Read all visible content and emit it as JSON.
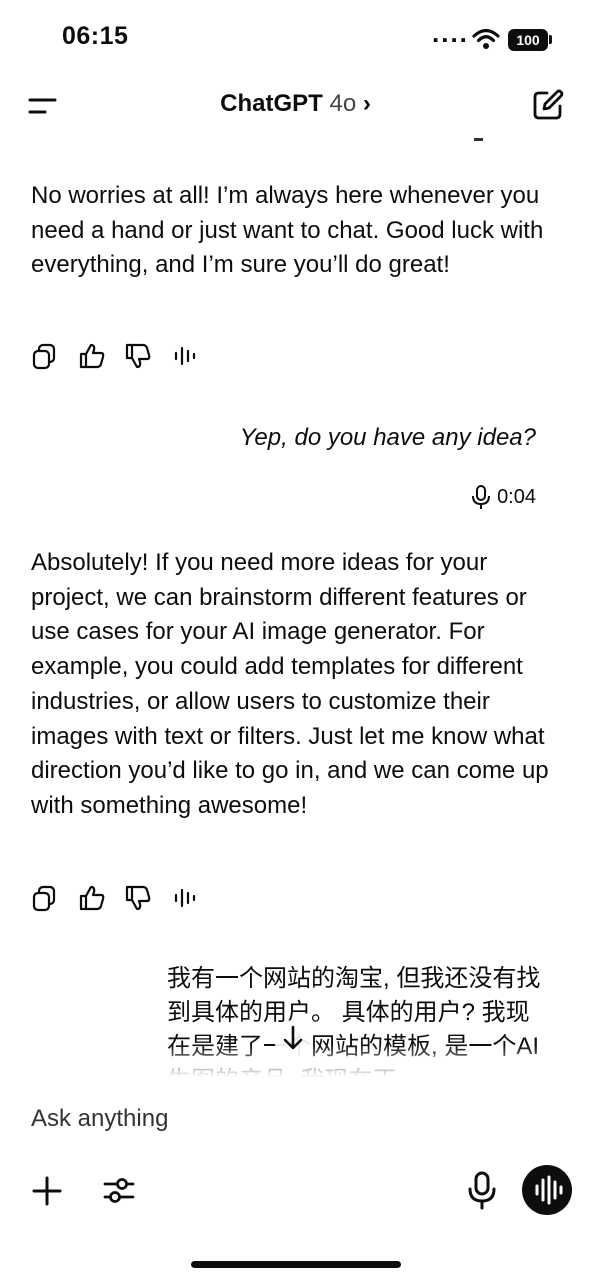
{
  "status_bar": {
    "time": "06:15",
    "signal": "....",
    "battery": "100"
  },
  "header": {
    "title": "ChatGPT",
    "model": "4o",
    "chevron": "›"
  },
  "messages": [
    {
      "role": "assistant",
      "text": "No worries at all! I’m always here whenever you need a hand or just want to chat. Good luck with everything, and I’m sure you’ll do great!"
    },
    {
      "role": "user",
      "text": "Yep, do you have any idea?",
      "voice_duration": "0:04"
    },
    {
      "role": "assistant",
      "text": "Absolutely! If you need more ideas for your project, we can brainstorm different features or use cases for your AI image generator. For example, you could add templates for different industries, or allow users to customize their images with text or filters. Just let me know what direction you’d like to go in, and we can come up with something awesome!"
    },
    {
      "role": "user",
      "text": "我有一个网站的淘宝, 但我还没有找到具体的用户。 具体的用户? 我现在是建了一个网站的模板, 是一个AI生图的产品, 我现在正"
    }
  ],
  "message_actions": [
    "copy-icon",
    "thumbs-up-icon",
    "thumbs-down-icon",
    "read-aloud-icon"
  ],
  "composer": {
    "placeholder": "Ask anything"
  },
  "icons": [
    "menu-icon",
    "new-chat-icon",
    "wifi-icon",
    "mic-icon",
    "scroll-down-icon",
    "plus-icon",
    "tools-icon",
    "voice-mode-icon"
  ]
}
